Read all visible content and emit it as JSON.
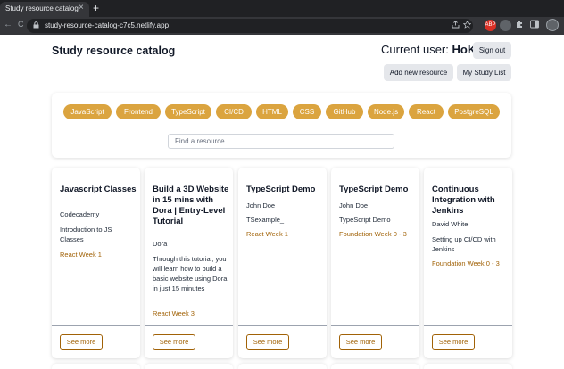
{
  "browser": {
    "tab_title": "Study resource catalog",
    "tab_close": "×",
    "new_tab": "+",
    "back": "←",
    "forward": "→",
    "reload": "C",
    "lock": "🔒",
    "url": "study-resource-catalog-c7c5.netlify.app",
    "ext_badge": "ABP"
  },
  "header": {
    "title": "Study resource catalog",
    "current_user_label": "Current user:",
    "current_user_name": "HoKei",
    "sign_out": "Sign out",
    "add_resource": "Add new resource",
    "study_list": "My Study List"
  },
  "filters": {
    "tags": [
      "JavaScript",
      "Frontend",
      "TypeScript",
      "CI/CD",
      "HTML",
      "CSS",
      "GitHub",
      "Node.js",
      "React",
      "PostgreSQL"
    ],
    "search_placeholder": "Find a resource",
    "tag_color": "#dba43f"
  },
  "cards": [
    {
      "title": "Javascript Classes",
      "author": "Codecademy",
      "description": "Introduction to JS Classes",
      "week": "React Week 1",
      "button": "See more"
    },
    {
      "title": "Build a 3D Website in 15 mins with Dora | Entry-Level Tutorial",
      "author": "Dora",
      "description": "Through this tutorial, you will learn how to build a basic website using Dora in just 15 minutes",
      "week": "React Week 3",
      "button": "See more"
    },
    {
      "title": "TypeScript Demo",
      "author": "John Doe",
      "description": "TSexample_",
      "week": "React Week 1",
      "button": "See more"
    },
    {
      "title": "TypeScript Demo",
      "author": "John Doe",
      "description": "TypeScript Demo",
      "week": "Foundation Week 0 - 3",
      "button": "See more"
    },
    {
      "title": "Continuous Integration with Jenkins",
      "author": "David White",
      "description": "Setting up CI/CD with Jenkins",
      "week": "Foundation Week 0 - 3",
      "button": "See more"
    }
  ],
  "colors": {
    "accent": "#dba43f",
    "week_text": "#a16207",
    "button_gray": "#e5e7eb"
  }
}
